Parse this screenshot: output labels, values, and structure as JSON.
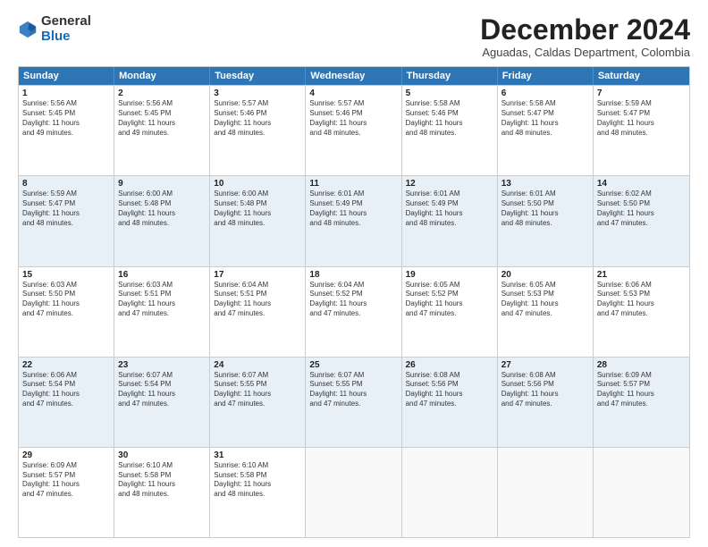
{
  "logo": {
    "general": "General",
    "blue": "Blue"
  },
  "title": "December 2024",
  "subtitle": "Aguadas, Caldas Department, Colombia",
  "header_days": [
    "Sunday",
    "Monday",
    "Tuesday",
    "Wednesday",
    "Thursday",
    "Friday",
    "Saturday"
  ],
  "weeks": [
    [
      {
        "day": "1",
        "info": "Sunrise: 5:56 AM\nSunset: 5:45 PM\nDaylight: 11 hours\nand 49 minutes."
      },
      {
        "day": "2",
        "info": "Sunrise: 5:56 AM\nSunset: 5:45 PM\nDaylight: 11 hours\nand 49 minutes."
      },
      {
        "day": "3",
        "info": "Sunrise: 5:57 AM\nSunset: 5:46 PM\nDaylight: 11 hours\nand 48 minutes."
      },
      {
        "day": "4",
        "info": "Sunrise: 5:57 AM\nSunset: 5:46 PM\nDaylight: 11 hours\nand 48 minutes."
      },
      {
        "day": "5",
        "info": "Sunrise: 5:58 AM\nSunset: 5:46 PM\nDaylight: 11 hours\nand 48 minutes."
      },
      {
        "day": "6",
        "info": "Sunrise: 5:58 AM\nSunset: 5:47 PM\nDaylight: 11 hours\nand 48 minutes."
      },
      {
        "day": "7",
        "info": "Sunrise: 5:59 AM\nSunset: 5:47 PM\nDaylight: 11 hours\nand 48 minutes."
      }
    ],
    [
      {
        "day": "8",
        "info": "Sunrise: 5:59 AM\nSunset: 5:47 PM\nDaylight: 11 hours\nand 48 minutes."
      },
      {
        "day": "9",
        "info": "Sunrise: 6:00 AM\nSunset: 5:48 PM\nDaylight: 11 hours\nand 48 minutes."
      },
      {
        "day": "10",
        "info": "Sunrise: 6:00 AM\nSunset: 5:48 PM\nDaylight: 11 hours\nand 48 minutes."
      },
      {
        "day": "11",
        "info": "Sunrise: 6:01 AM\nSunset: 5:49 PM\nDaylight: 11 hours\nand 48 minutes."
      },
      {
        "day": "12",
        "info": "Sunrise: 6:01 AM\nSunset: 5:49 PM\nDaylight: 11 hours\nand 48 minutes."
      },
      {
        "day": "13",
        "info": "Sunrise: 6:01 AM\nSunset: 5:50 PM\nDaylight: 11 hours\nand 48 minutes."
      },
      {
        "day": "14",
        "info": "Sunrise: 6:02 AM\nSunset: 5:50 PM\nDaylight: 11 hours\nand 47 minutes."
      }
    ],
    [
      {
        "day": "15",
        "info": "Sunrise: 6:03 AM\nSunset: 5:50 PM\nDaylight: 11 hours\nand 47 minutes."
      },
      {
        "day": "16",
        "info": "Sunrise: 6:03 AM\nSunset: 5:51 PM\nDaylight: 11 hours\nand 47 minutes."
      },
      {
        "day": "17",
        "info": "Sunrise: 6:04 AM\nSunset: 5:51 PM\nDaylight: 11 hours\nand 47 minutes."
      },
      {
        "day": "18",
        "info": "Sunrise: 6:04 AM\nSunset: 5:52 PM\nDaylight: 11 hours\nand 47 minutes."
      },
      {
        "day": "19",
        "info": "Sunrise: 6:05 AM\nSunset: 5:52 PM\nDaylight: 11 hours\nand 47 minutes."
      },
      {
        "day": "20",
        "info": "Sunrise: 6:05 AM\nSunset: 5:53 PM\nDaylight: 11 hours\nand 47 minutes."
      },
      {
        "day": "21",
        "info": "Sunrise: 6:06 AM\nSunset: 5:53 PM\nDaylight: 11 hours\nand 47 minutes."
      }
    ],
    [
      {
        "day": "22",
        "info": "Sunrise: 6:06 AM\nSunset: 5:54 PM\nDaylight: 11 hours\nand 47 minutes."
      },
      {
        "day": "23",
        "info": "Sunrise: 6:07 AM\nSunset: 5:54 PM\nDaylight: 11 hours\nand 47 minutes."
      },
      {
        "day": "24",
        "info": "Sunrise: 6:07 AM\nSunset: 5:55 PM\nDaylight: 11 hours\nand 47 minutes."
      },
      {
        "day": "25",
        "info": "Sunrise: 6:07 AM\nSunset: 5:55 PM\nDaylight: 11 hours\nand 47 minutes."
      },
      {
        "day": "26",
        "info": "Sunrise: 6:08 AM\nSunset: 5:56 PM\nDaylight: 11 hours\nand 47 minutes."
      },
      {
        "day": "27",
        "info": "Sunrise: 6:08 AM\nSunset: 5:56 PM\nDaylight: 11 hours\nand 47 minutes."
      },
      {
        "day": "28",
        "info": "Sunrise: 6:09 AM\nSunset: 5:57 PM\nDaylight: 11 hours\nand 47 minutes."
      }
    ],
    [
      {
        "day": "29",
        "info": "Sunrise: 6:09 AM\nSunset: 5:57 PM\nDaylight: 11 hours\nand 47 minutes."
      },
      {
        "day": "30",
        "info": "Sunrise: 6:10 AM\nSunset: 5:58 PM\nDaylight: 11 hours\nand 48 minutes."
      },
      {
        "day": "31",
        "info": "Sunrise: 6:10 AM\nSunset: 5:58 PM\nDaylight: 11 hours\nand 48 minutes."
      },
      {
        "day": "",
        "info": ""
      },
      {
        "day": "",
        "info": ""
      },
      {
        "day": "",
        "info": ""
      },
      {
        "day": "",
        "info": ""
      }
    ]
  ]
}
